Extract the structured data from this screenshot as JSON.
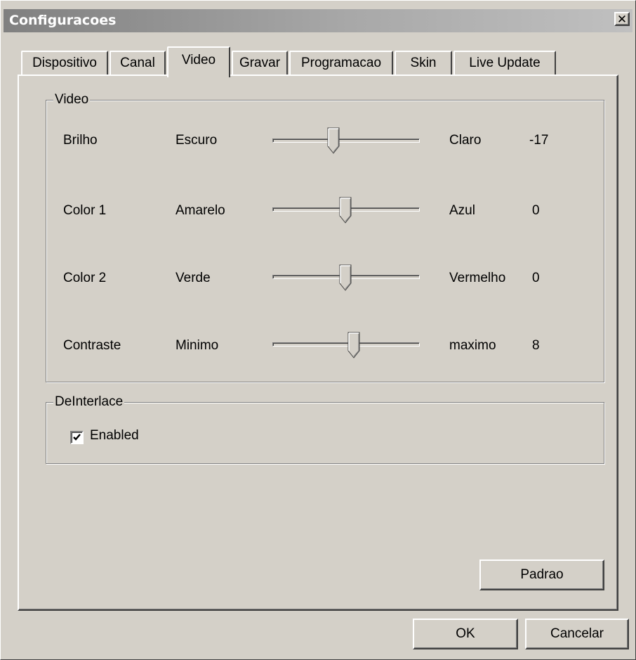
{
  "window": {
    "title": "Configuracoes",
    "close_glyph": "✕"
  },
  "tabs": [
    {
      "label": "Dispositivo",
      "active": false
    },
    {
      "label": "Canal",
      "active": false
    },
    {
      "label": "Video",
      "active": true
    },
    {
      "label": "Gravar",
      "active": false
    },
    {
      "label": "Programacao",
      "active": false
    },
    {
      "label": "Skin",
      "active": false
    },
    {
      "label": "Live Update",
      "active": false
    }
  ],
  "video_group": {
    "legend": "Video",
    "sliders": [
      {
        "name": "Brilho",
        "min_label": "Escuro",
        "max_label": "Claro",
        "value": "-17",
        "position": 0.42
      },
      {
        "name": "Color 1",
        "min_label": "Amarelo",
        "max_label": "Azul",
        "value": "0",
        "position": 0.5
      },
      {
        "name": "Color 2",
        "min_label": "Verde",
        "max_label": "Vermelho",
        "value": "0",
        "position": 0.5
      },
      {
        "name": "Contraste",
        "min_label": "Minimo",
        "max_label": "maximo",
        "value": "8",
        "position": 0.56
      }
    ]
  },
  "deinterlace_group": {
    "legend": "DeInterlace",
    "checkbox_label": "Enabled",
    "checked": true
  },
  "buttons": {
    "default": "Padrao",
    "ok": "OK",
    "cancel": "Cancelar"
  }
}
